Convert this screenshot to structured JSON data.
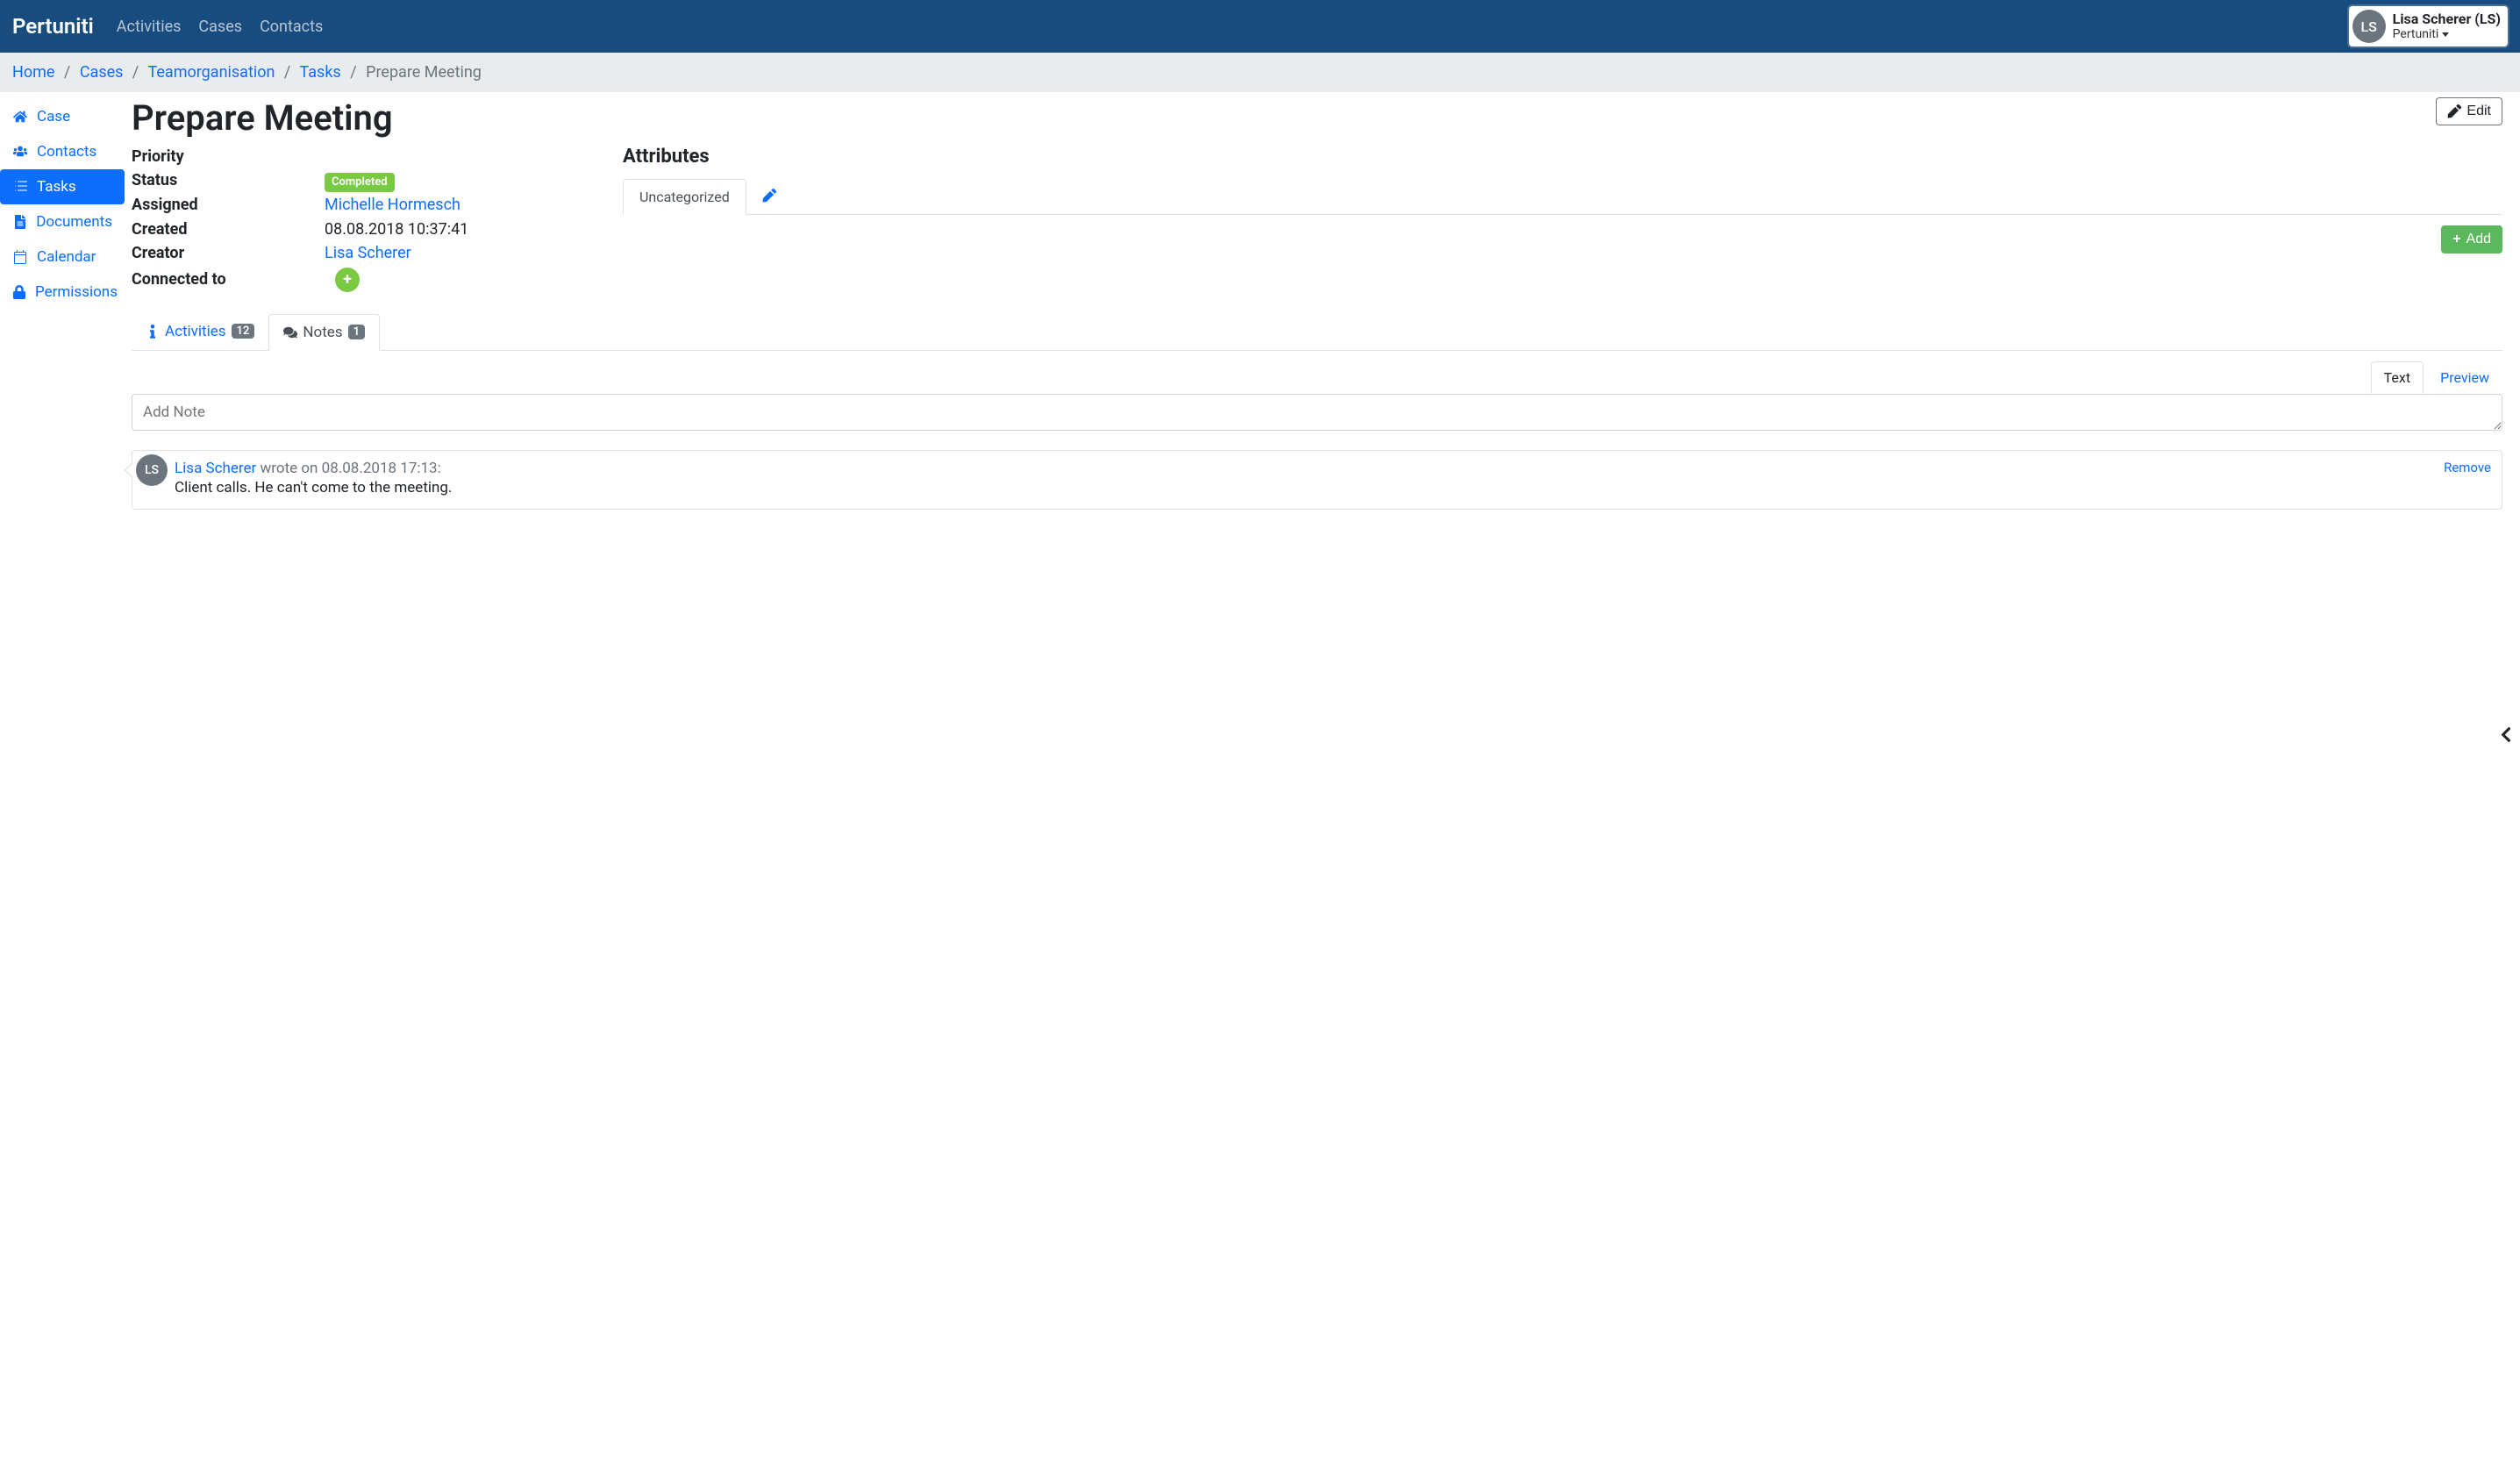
{
  "brand": "Pertuniti",
  "topnav": {
    "activities": "Activities",
    "cases": "Cases",
    "contacts": "Contacts"
  },
  "user": {
    "initials": "LS",
    "display_name": "Lisa Scherer (LS)",
    "org": "Pertuniti"
  },
  "breadcrumb": {
    "home": "Home",
    "cases": "Cases",
    "team": "Teamorganisation",
    "tasks": "Tasks",
    "current": "Prepare Meeting"
  },
  "sidebar": {
    "case": "Case",
    "contacts": "Contacts",
    "tasks": "Tasks",
    "documents": "Documents",
    "calendar": "Calendar",
    "permissions": "Permissions"
  },
  "page": {
    "title": "Prepare Meeting",
    "edit_label": "Edit"
  },
  "details": {
    "labels": {
      "priority": "Priority",
      "status": "Status",
      "assigned": "Assigned",
      "created": "Created",
      "creator": "Creator",
      "connected_to": "Connected to"
    },
    "values": {
      "priority": "",
      "status_badge": "Completed",
      "assigned": "Michelle Hormesch",
      "created": "08.08.2018 10:37:41",
      "creator": "Lisa Scherer"
    }
  },
  "attributes": {
    "title": "Attributes",
    "tab_uncategorized": "Uncategorized",
    "add_label": "Add"
  },
  "subtabs": {
    "activities_label": "Activities",
    "activities_count": "12",
    "notes_label": "Notes",
    "notes_count": "1"
  },
  "editor": {
    "text_tab": "Text",
    "preview_tab": "Preview",
    "placeholder": "Add Note"
  },
  "note": {
    "author_initials": "LS",
    "author": "Lisa Scherer",
    "meta": " wrote on 08.08.2018 17:13:",
    "body": "Client calls. He can't come to the meeting.",
    "remove_label": "Remove"
  }
}
